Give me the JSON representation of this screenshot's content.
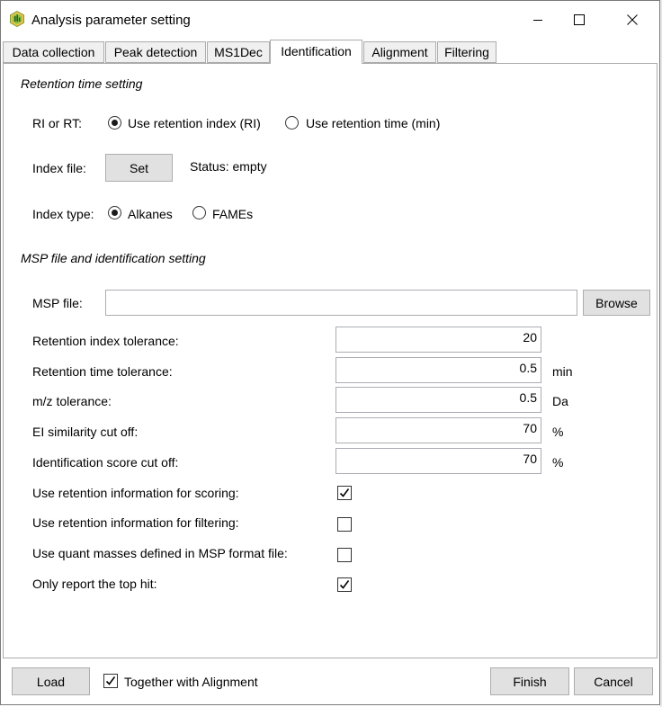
{
  "window": {
    "title": "Analysis parameter setting"
  },
  "tabs": [
    "Data collection",
    "Peak detection",
    "MS1Dec",
    "Identification",
    "Alignment",
    "Filtering"
  ],
  "retention": {
    "section_title": "Retention time setting",
    "ri_or_rt_label": "RI or RT:",
    "option_ri": "Use retention index (RI)",
    "option_rt": "Use retention time (min)",
    "selected": "ri",
    "index_file_label": "Index file:",
    "set_button": "Set",
    "status_text": "Status: empty",
    "index_type_label": "Index type:",
    "option_alkanes": "Alkanes",
    "option_fames": "FAMEs"
  },
  "msp": {
    "section_title": "MSP file and identification setting",
    "msp_file_label": "MSP file:",
    "msp_file_value": "",
    "browse_button": "Browse"
  },
  "params": [
    {
      "label": "Retention index tolerance:",
      "value": "20",
      "unit": ""
    },
    {
      "label": "Retention time tolerance:",
      "value": "0.5",
      "unit": "min"
    },
    {
      "label": "m/z tolerance:",
      "value": "0.5",
      "unit": "Da"
    },
    {
      "label": "EI similarity cut off:",
      "value": "70",
      "unit": "%"
    },
    {
      "label": "Identification score cut off:",
      "value": "70",
      "unit": "%"
    }
  ],
  "options": [
    {
      "label": "Use retention information for scoring:",
      "checked": true
    },
    {
      "label": "Use retention information for filtering:",
      "checked": false
    },
    {
      "label": "Use quant masses defined in MSP format file:",
      "checked": false
    },
    {
      "label": "Only report the top hit:",
      "checked": true
    }
  ],
  "footer": {
    "load_button": "Load",
    "together_label": "Together with Alignment",
    "together_checked": true,
    "finish_button": "Finish",
    "cancel_button": "Cancel"
  },
  "colors": {
    "tab_bg": "#f0f0f0",
    "button_bg": "#e1e1e1",
    "border": "#acacac"
  },
  "icons": {
    "app": "analysis-app-icon",
    "minimize": "minimize-icon",
    "maximize": "maximize-icon",
    "close": "close-icon",
    "check": "checkmark-icon"
  }
}
